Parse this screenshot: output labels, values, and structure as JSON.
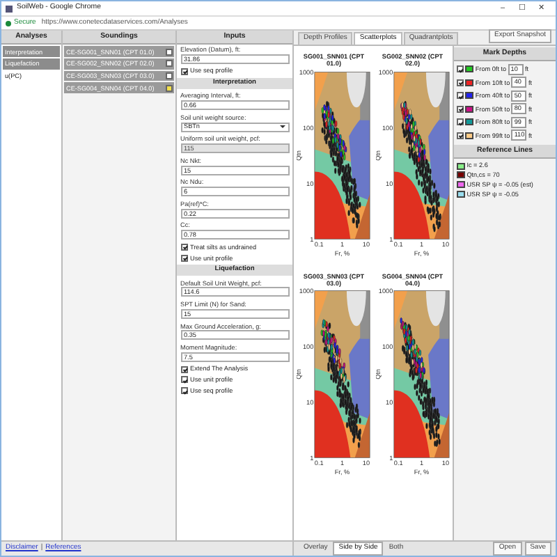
{
  "window": {
    "title": "SoilWeb - Google Chrome",
    "controls": [
      "–",
      "☐",
      "✕"
    ]
  },
  "address_bar": {
    "secure_label": "Secure",
    "url": "https://www.conetecdataservices.com/Analyses"
  },
  "analyses": {
    "header": "Analyses",
    "items": [
      {
        "label": "Interpretation",
        "selected": true
      },
      {
        "label": "Liquefaction",
        "selected": true
      },
      {
        "label": "u(PC)",
        "selected": false
      }
    ]
  },
  "soundings": {
    "header": "Soundings",
    "items": [
      {
        "label": "CE-SG001_SNN01 (CPT 01.0)",
        "checked": false
      },
      {
        "label": "CE-SG002_SNN02 (CPT 02.0)",
        "checked": false
      },
      {
        "label": "CE-SG003_SNN03 (CPT 03.0)",
        "checked": false
      },
      {
        "label": "CE-SG004_SNN04 (CPT 04.0)",
        "checked": true
      }
    ]
  },
  "inputs": {
    "header": "Inputs",
    "items": [
      {
        "kind": "field",
        "label": "Elevation (Datum), ft:",
        "value": "31.86",
        "disabled": false
      },
      {
        "kind": "check",
        "label": "Use seq profile",
        "checked": true
      },
      {
        "kind": "section",
        "title": "Interpretation"
      },
      {
        "kind": "field",
        "label": "Averaging Interval, ft:",
        "value": "0.66",
        "disabled": false
      },
      {
        "kind": "select",
        "label": "Soil unit weight source:",
        "value": "SBTn"
      },
      {
        "kind": "field",
        "label": "Uniform soil unit weight, pcf:",
        "value": "115",
        "disabled": true
      },
      {
        "kind": "field",
        "label": "Nc Nkt:",
        "value": "15",
        "disabled": false
      },
      {
        "kind": "field",
        "label": "Nc Ndu:",
        "value": "6",
        "disabled": false
      },
      {
        "kind": "field",
        "label": "Pa(ref)*C:",
        "value": "0.22",
        "disabled": false
      },
      {
        "kind": "field",
        "label": "Cc:",
        "value": "0.78",
        "disabled": false
      },
      {
        "kind": "check",
        "label": "Treat silts as undrained",
        "checked": true
      },
      {
        "kind": "check",
        "label": "Use unit profile",
        "checked": true
      },
      {
        "kind": "section",
        "title": "Liquefaction"
      },
      {
        "kind": "field",
        "label": "Default Soil Unit Weight, pcf:",
        "value": "114.6",
        "disabled": false
      },
      {
        "kind": "field",
        "label": "SPT Limit (N) for Sand:",
        "value": "15",
        "disabled": false
      },
      {
        "kind": "field",
        "label": "Max Ground Acceleration, g:",
        "value": "0.35",
        "disabled": false
      },
      {
        "kind": "field",
        "label": "Moment Magnitude:",
        "value": "7.5",
        "disabled": false
      },
      {
        "kind": "check",
        "label": "Extend The Analysis",
        "checked": true
      },
      {
        "kind": "check",
        "label": "Use unit profile",
        "checked": true
      },
      {
        "kind": "check",
        "label": "Use seq profile",
        "checked": true
      }
    ]
  },
  "footer_links": [
    "Disclaimer",
    "References"
  ],
  "footer_separator": "|",
  "view_tabs": [
    {
      "label": "Depth Profiles",
      "selected": false
    },
    {
      "label": "Scatterplots",
      "selected": true
    },
    {
      "label": "Quadrantplots",
      "selected": false
    }
  ],
  "export_button": "Export Snapshot",
  "charts": [
    {
      "title": "SG001_SNN01 (CPT 01.0)",
      "xlabel": "Fr, %",
      "ylabel": "Qtn",
      "xticks": [
        "0.1",
        "1",
        "10"
      ],
      "yticks": [
        "1000",
        "100",
        "10",
        "1"
      ]
    },
    {
      "title": "SG002_SNN02 (CPT 02.0)",
      "xlabel": "Fr, %",
      "ylabel": "Qtn",
      "xticks": [
        "0.1",
        "1",
        "10"
      ],
      "yticks": [
        "1000",
        "100",
        "10",
        "1"
      ]
    },
    {
      "title": "SG003_SNN03 (CPT 03.0)",
      "xlabel": "Fr, %",
      "ylabel": "Qtn",
      "xticks": [
        "0.1",
        "1",
        "10"
      ],
      "yticks": [
        "1000",
        "100",
        "10",
        "1"
      ]
    },
    {
      "title": "SG004_SNN04 (CPT 04.0)",
      "xlabel": "Fr, %",
      "ylabel": "Qtn",
      "xticks": [
        "0.1",
        "1",
        "10"
      ],
      "yticks": [
        "1000",
        "100",
        "10",
        "1"
      ]
    }
  ],
  "mark_depths": {
    "header": "Mark Depths",
    "items": [
      {
        "label": "From 0ft to",
        "value": "10",
        "unit": "ft",
        "checked": true,
        "color": "#22cc22"
      },
      {
        "label": "From 10ft to",
        "value": "40",
        "unit": "ft",
        "checked": true,
        "color": "#ee2222"
      },
      {
        "label": "From 40ft to",
        "value": "50",
        "unit": "ft",
        "checked": true,
        "color": "#2222ee"
      },
      {
        "label": "From 50ft to",
        "value": "80",
        "unit": "ft",
        "checked": true,
        "color": "#cc1188"
      },
      {
        "label": "From 80ft to",
        "value": "99",
        "unit": "ft",
        "checked": true,
        "color": "#119999"
      },
      {
        "label": "From 99ft to",
        "value": "110",
        "unit": "ft",
        "checked": true,
        "color": "#ffcc88"
      }
    ]
  },
  "reference_lines": {
    "header": "Reference Lines",
    "items": [
      {
        "label": "Ic = 2.6",
        "color": "#88ee88"
      },
      {
        "label": "Qtn,cs = 70",
        "color": "#770000"
      },
      {
        "label": "USR SP ψ = -0.05 (est)",
        "color": "#ee66ee"
      },
      {
        "label": "USR SP ψ = -0.05",
        "color": "#99ddee"
      }
    ]
  },
  "display_tabs": [
    {
      "label": "Overlay",
      "selected": false
    },
    {
      "label": "Side by Side",
      "selected": true
    },
    {
      "label": "Both",
      "selected": false
    }
  ],
  "file_buttons": [
    "Open",
    "Save"
  ]
}
